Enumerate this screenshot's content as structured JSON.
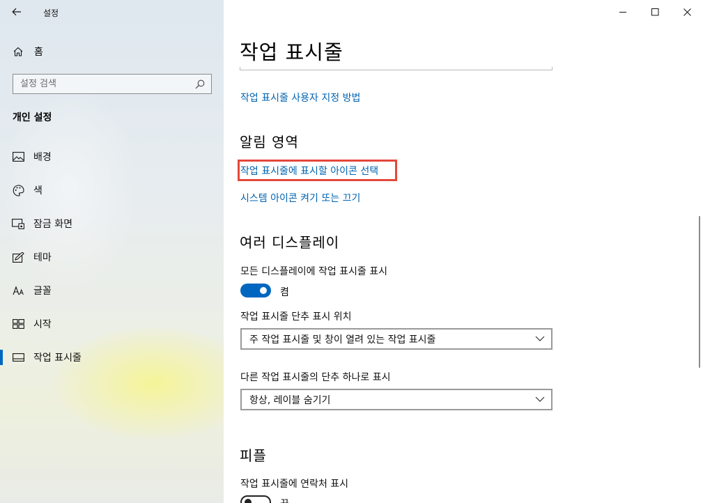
{
  "window": {
    "app_title": "설정"
  },
  "sidebar": {
    "home_label": "홈",
    "search_placeholder": "설정 검색",
    "section_title": "개인 설정",
    "items": [
      {
        "label": "배경",
        "icon": "picture-icon",
        "active": false
      },
      {
        "label": "색",
        "icon": "palette-icon",
        "active": false
      },
      {
        "label": "잠금 화면",
        "icon": "lock-screen-icon",
        "active": false
      },
      {
        "label": "테마",
        "icon": "theme-icon",
        "active": false
      },
      {
        "label": "글꼴",
        "icon": "font-icon",
        "active": false
      },
      {
        "label": "시작",
        "icon": "start-icon",
        "active": false
      },
      {
        "label": "작업 표시줄",
        "icon": "taskbar-icon",
        "active": true
      }
    ]
  },
  "main": {
    "page_title": "작업 표시줄",
    "customize_link": "작업 표시줄 사용자 지정 방법",
    "notification_area": {
      "heading": "알림 영역",
      "select_icons_link": "작업 표시줄에 표시할 아이콘 선택",
      "system_icons_link": "시스템 아이콘 켜기 또는 끄기"
    },
    "multiple_displays": {
      "heading": "여러 디스플레이",
      "show_on_all_label": "모든 디스플레이에 작업 표시줄 표시",
      "show_on_all_state": "켬",
      "buttons_position_label": "작업 표시줄 단추 표시 위치",
      "buttons_position_value": "주 작업 표시줄 및 창이 열려 있는 작업 표시줄",
      "combine_label": "다른 작업 표시줄의 단추 하나로 표시",
      "combine_value": "항상, 레이블 숨기기"
    },
    "people": {
      "heading": "피플",
      "show_contacts_label": "작업 표시줄에 연락처 표시",
      "show_contacts_state": "끔"
    }
  },
  "colors": {
    "accent": "#0067c0",
    "link": "#0063b1",
    "highlight_box": "#e4473a"
  }
}
